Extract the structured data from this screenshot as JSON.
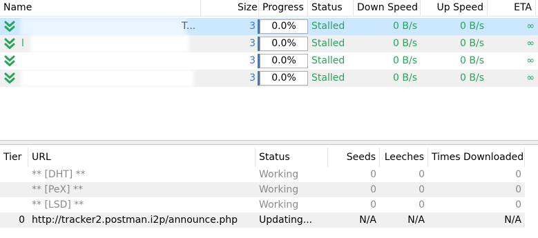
{
  "torrent_list": {
    "columns": {
      "name": "Name",
      "size": "Size",
      "progress": "Progress",
      "status": "Status",
      "down_speed": "Down Speed",
      "up_speed": "Up Speed",
      "eta": "ETA"
    },
    "rows": [
      {
        "name_fragment": "T...",
        "size_fragment": "3",
        "progress": "0.0%",
        "status": "Stalled",
        "down_speed": "0 B/s",
        "up_speed": "0 B/s",
        "eta": "∞"
      },
      {
        "name_fragment": "l",
        "size_fragment": "3",
        "progress": "0.0%",
        "status": "Stalled",
        "down_speed": "0 B/s",
        "up_speed": "0 B/s",
        "eta": "∞"
      },
      {
        "name_fragment": "",
        "size_fragment": "3",
        "progress": "0.0%",
        "status": "Stalled",
        "down_speed": "0 B/s",
        "up_speed": "0 B/s",
        "eta": "∞"
      },
      {
        "name_fragment": "",
        "size_fragment": "3",
        "progress": "0.0%",
        "status": "Stalled",
        "down_speed": "0 B/s",
        "up_speed": "0 B/s",
        "eta": "∞"
      }
    ]
  },
  "trackers": {
    "columns": {
      "tier": "Tier",
      "url": "URL",
      "status": "Status",
      "seeds": "Seeds",
      "leeches": "Leeches",
      "times_downloaded": "Times Downloaded"
    },
    "rows": [
      {
        "tier": "",
        "url": "** [DHT] **",
        "status": "Working",
        "seeds": "0",
        "leeches": "0",
        "times_downloaded": "0"
      },
      {
        "tier": "",
        "url": "** [PeX] **",
        "status": "Working",
        "seeds": "0",
        "leeches": "0",
        "times_downloaded": "0"
      },
      {
        "tier": "",
        "url": "** [LSD] **",
        "status": "Working",
        "seeds": "0",
        "leeches": "0",
        "times_downloaded": "0"
      },
      {
        "tier": "0",
        "url": "http://tracker2.postman.i2p/announce.php",
        "status": "Updating...",
        "seeds": "N/A",
        "leeches": "N/A",
        "times_downloaded": "N/A"
      }
    ]
  },
  "colors": {
    "stalled_green": "#27a55a",
    "selected_row": "#cce8ff",
    "alt_row": "#f0f0f0",
    "progress_edge": "#3c79c9"
  },
  "icons": {
    "row_status": "double-chevron-down-icon"
  }
}
